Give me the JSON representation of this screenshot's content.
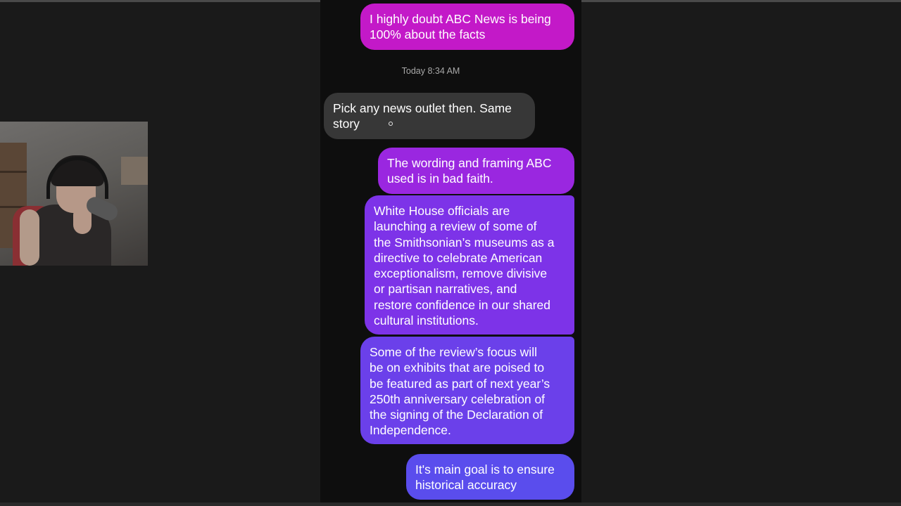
{
  "conversation": {
    "messages": [
      {
        "direction": "sent",
        "text": "I highly doubt ABC News is being\n100% about the facts",
        "color": "#c319c8"
      },
      {
        "direction": "received",
        "text": "Pick any news outlet then. Same\nstory",
        "color": "#373737"
      },
      {
        "direction": "sent",
        "text": "The wording and framing ABC\nused is in bad faith.",
        "color": "#9a27e0"
      },
      {
        "direction": "sent",
        "text": "White House officials are\nlaunching a review of some of\nthe Smithsonian’s museums as a\ndirective to celebrate American\nexceptionalism, remove divisive\nor partisan narratives, and\nrestore confidence in our shared\ncultural institutions.",
        "color": "#7d33e8"
      },
      {
        "direction": "sent",
        "text": "Some of the review’s focus will\nbe on exhibits that are poised to\nbe featured as part of next year’s\n250th anniversary celebration of\nthe signing of the Declaration of\nIndependence.",
        "color": "#6b40ea"
      },
      {
        "direction": "sent",
        "text": "It's main goal is to ensure\nhistorical accuracy",
        "color": "#5a4ded"
      }
    ],
    "timestamp": "Today 8:34 AM"
  },
  "webcam": {
    "description_icon": "webcam-feed"
  },
  "colors": {
    "background": "#1a1a1a",
    "chat_background": "#0e0e0e",
    "received_bubble": "#373737"
  }
}
